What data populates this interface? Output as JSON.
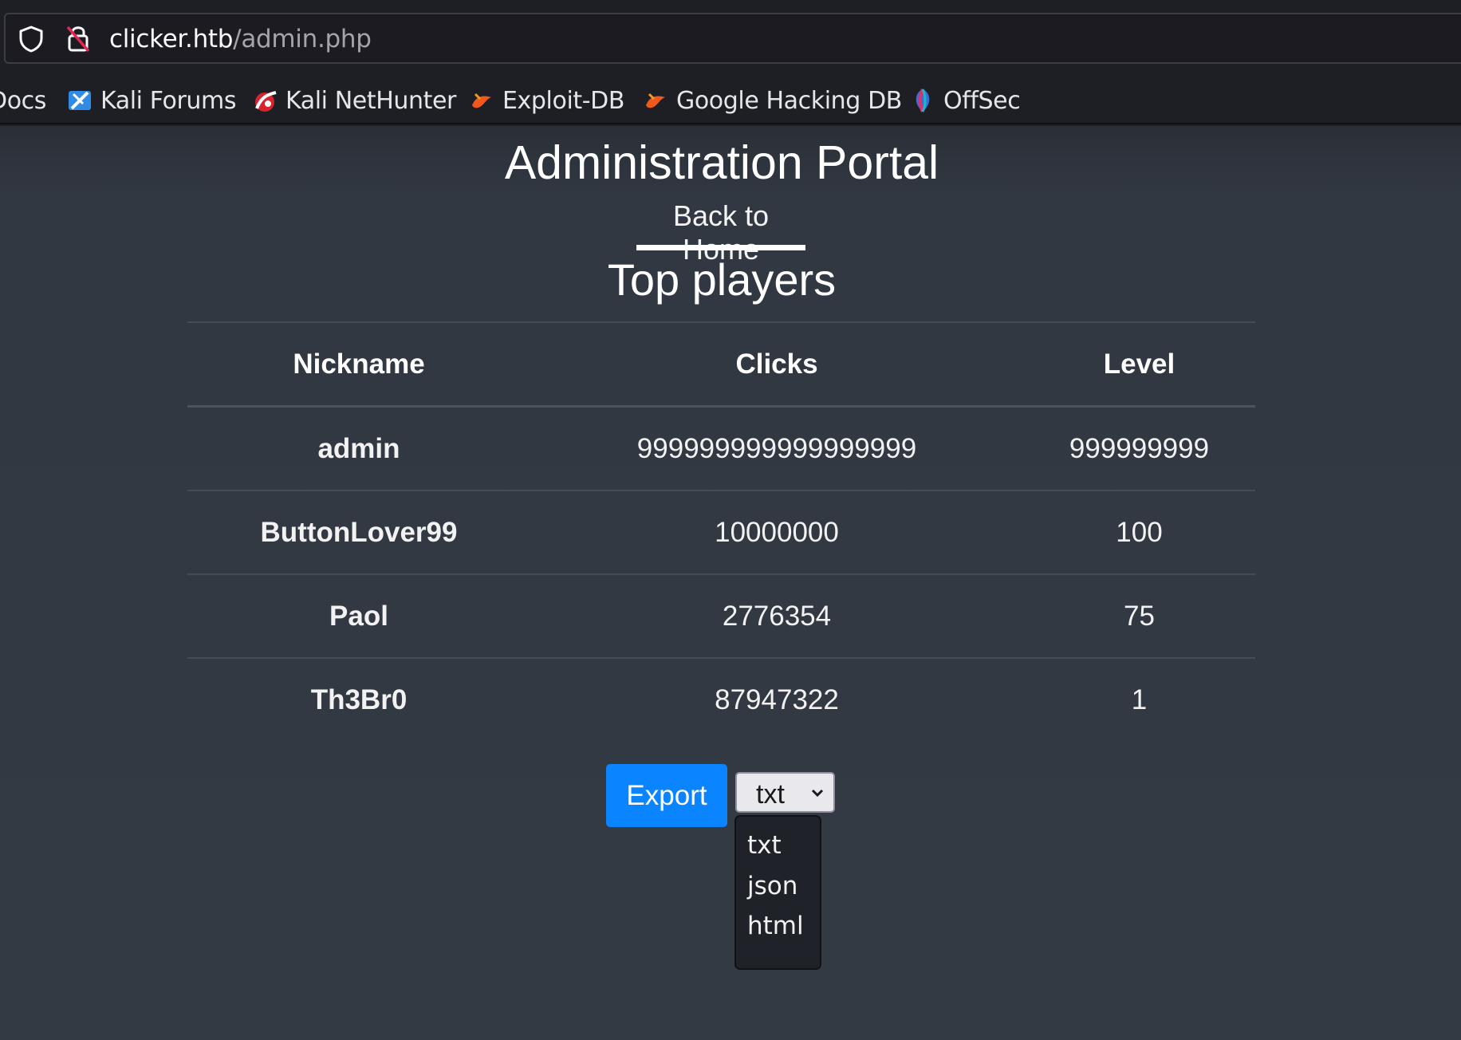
{
  "browser": {
    "url_host": "clicker.htb",
    "url_path": "/admin.php",
    "bookmarks": [
      {
        "label": "Docs",
        "icon": "kali-docs-icon"
      },
      {
        "label": "Kali Forums",
        "icon": "kali-forums-icon"
      },
      {
        "label": "Kali NetHunter",
        "icon": "kali-nethunter-icon"
      },
      {
        "label": "Exploit-DB",
        "icon": "exploit-db-icon"
      },
      {
        "label": "Google Hacking DB",
        "icon": "google-hacking-db-icon"
      },
      {
        "label": "OffSec",
        "icon": "offsec-icon"
      }
    ]
  },
  "page": {
    "title": "Administration Portal",
    "home_link": "Back to Home",
    "subtitle": "Top players"
  },
  "table": {
    "headers": [
      "Nickname",
      "Clicks",
      "Level"
    ],
    "rows": [
      [
        "admin",
        "999999999999999999",
        "999999999"
      ],
      [
        "ButtonLover99",
        "10000000",
        "100"
      ],
      [
        "Paol",
        "2776354",
        "75"
      ],
      [
        "Th3Br0",
        "87947322",
        "1"
      ]
    ]
  },
  "export": {
    "button_label": "Export",
    "selected": "txt",
    "options": [
      "txt",
      "json",
      "html"
    ],
    "button_color": "#0a84ff"
  }
}
